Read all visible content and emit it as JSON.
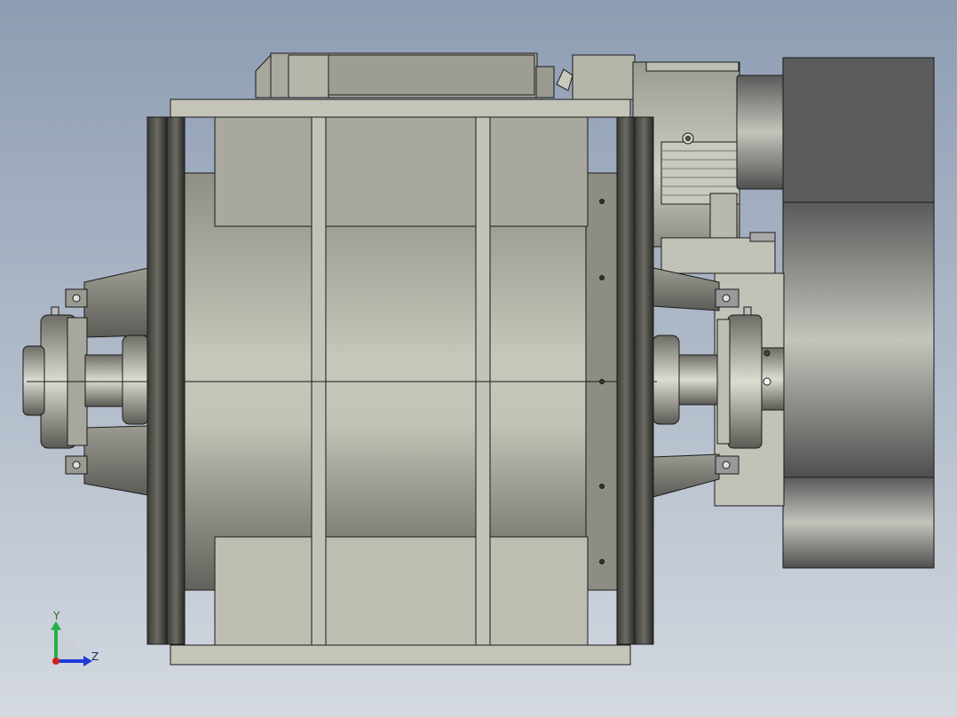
{
  "viewport": {
    "background_top": "#8e9db3",
    "background_bottom": "#d4d9e0"
  },
  "triad": {
    "y_label": "Y",
    "z_label": "Z",
    "y_color": "#22b14c",
    "z_color": "#1f3ad6",
    "x_color": "#d12020"
  },
  "model": {
    "body_color": "#b9b9ab",
    "edge_color": "#1a1a1a",
    "motor_color": "#5e5e5e"
  }
}
